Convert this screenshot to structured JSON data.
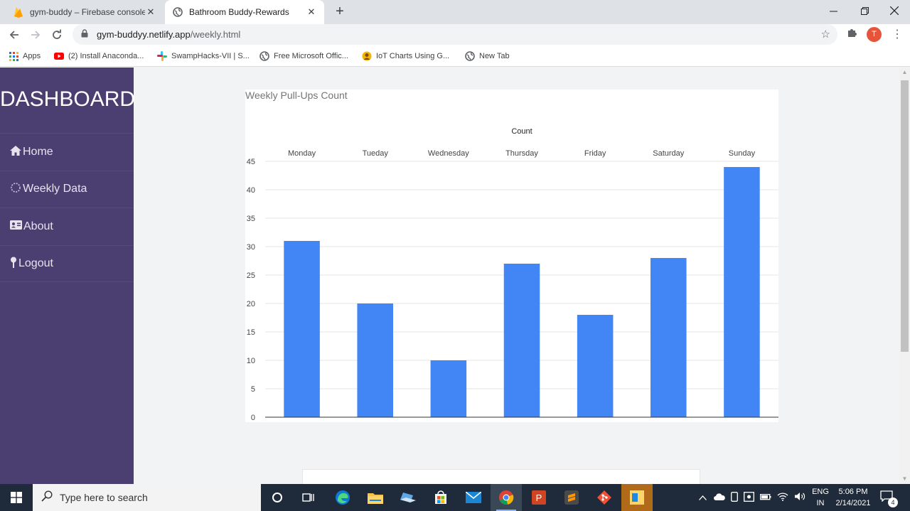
{
  "browser": {
    "tabs": [
      {
        "title": "gym-buddy – Firebase console",
        "icon": "firebase-icon"
      },
      {
        "title": "Bathroom Buddy-Rewards",
        "icon": "globe-icon"
      }
    ],
    "address": {
      "host": "gym-buddyy.netlify.app",
      "path": "/weekly.html"
    },
    "profile_initial": "T",
    "bookmarks": [
      {
        "label": "Apps",
        "icon": "apps-grid-icon"
      },
      {
        "label": "(2) Install Anaconda...",
        "icon": "youtube-icon"
      },
      {
        "label": "SwampHacks-VII | S...",
        "icon": "slack-icon"
      },
      {
        "label": "Free Microsoft Offic...",
        "icon": "globe-icon"
      },
      {
        "label": "IoT Charts Using G...",
        "icon": "avatar-icon"
      },
      {
        "label": "New Tab",
        "icon": "globe-icon"
      }
    ]
  },
  "sidebar": {
    "brand": "DASHBOARD",
    "items": [
      {
        "label": "Home",
        "icon": "home-icon"
      },
      {
        "label": " Weekly Data",
        "icon": "spinner-icon"
      },
      {
        "label": "About",
        "icon": "id-card-icon"
      },
      {
        "label": "Logout",
        "icon": "pin-icon"
      }
    ]
  },
  "colors": {
    "sidebar": "#4b3f72",
    "bar": "#4285f4",
    "taskbar": "#1f2b3a"
  },
  "chart_data": {
    "type": "bar",
    "title": "Weekly Pull-Ups Count",
    "axis_title": "Count",
    "categories": [
      "Monday",
      "Tueday",
      "Wednesday",
      "Thursday",
      "Friday",
      "Saturday",
      "Sunday"
    ],
    "series": [
      {
        "name": "Count",
        "values": [
          31,
          20,
          10,
          27,
          18,
          28,
          44
        ]
      }
    ],
    "ylim": [
      0,
      45
    ],
    "yticks": [
      0,
      5,
      10,
      15,
      20,
      25,
      30,
      35,
      40,
      45
    ],
    "category_axis_position": "top",
    "grid": true,
    "bar_color": "#4285f4"
  },
  "taskbar": {
    "search_placeholder": "Type here to search",
    "language": "ENG",
    "region": "IN",
    "time": "5:06 PM",
    "date": "2/14/2021",
    "notification_count": "4"
  }
}
